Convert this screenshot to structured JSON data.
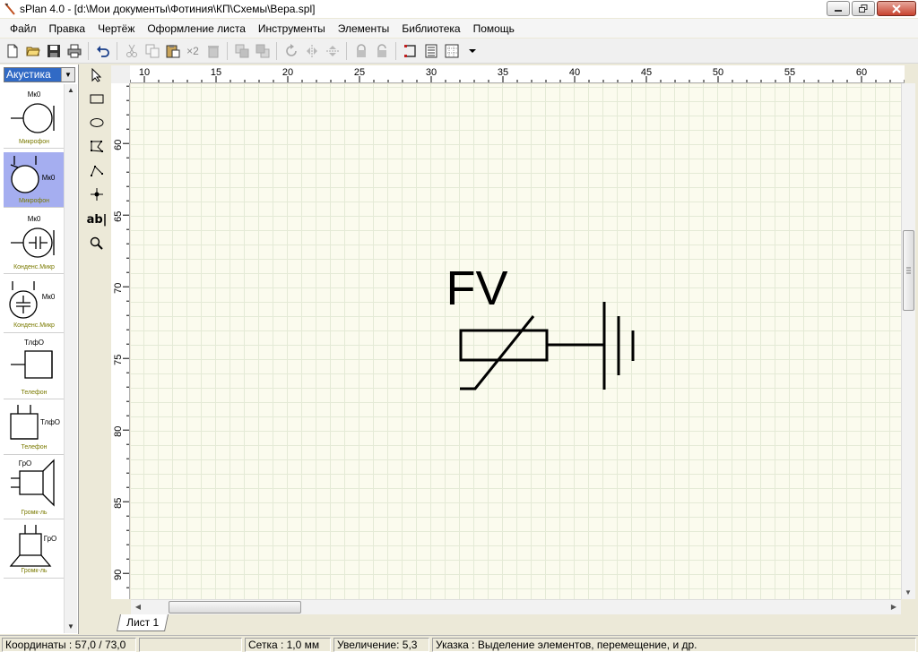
{
  "window": {
    "title": "sPlan 4.0 - [d:\\Мои документы\\Фотиния\\КП\\Схемы\\Вера.spl]"
  },
  "menu": [
    {
      "label": "Файл"
    },
    {
      "label": "Правка"
    },
    {
      "label": "Чертёж"
    },
    {
      "label": "Оформление листа"
    },
    {
      "label": "Инструменты"
    },
    {
      "label": "Элементы"
    },
    {
      "label": "Библиотека"
    },
    {
      "label": "Помощь"
    }
  ],
  "toolbar": {
    "duplicate_label": "×2"
  },
  "library": {
    "selected": "Акустика",
    "items": [
      {
        "caption": "Микрофон",
        "tag": "Мк0",
        "icon": "microphone-icon",
        "selected": false
      },
      {
        "caption": "Микрофон",
        "tag": "Мк0",
        "icon": "microphone-icon",
        "selected": true
      },
      {
        "caption": "Конденс.Микр",
        "tag": "Мк0",
        "icon": "condenser-mic-icon",
        "selected": false
      },
      {
        "caption": "Конденс.Микр",
        "tag": "Мк0",
        "icon": "condenser-mic-icon",
        "selected": false
      },
      {
        "caption": "Телефон",
        "tag": "ТлфО",
        "icon": "phone-icon",
        "selected": false
      },
      {
        "caption": "Телефон",
        "tag": "ТлфО",
        "icon": "phone-icon",
        "selected": false
      },
      {
        "caption": "Громк-ль",
        "tag": "ГрО",
        "icon": "speaker-icon",
        "selected": false
      },
      {
        "caption": "Громк-ль",
        "tag": "ГрО",
        "icon": "horn-speaker-icon",
        "selected": false
      }
    ]
  },
  "tools": {
    "text_tool_label": "ab|"
  },
  "ruler": {
    "top_ticks": [
      "10",
      "15",
      "20",
      "25",
      "30",
      "35",
      "40",
      "45",
      "50",
      "55",
      "60"
    ],
    "left_ticks": [
      "60",
      "65",
      "70",
      "75",
      "80",
      "85",
      "90"
    ]
  },
  "drawing": {
    "component_label": "FV"
  },
  "sheet_tab": "Лист 1",
  "status": {
    "coords": "Координаты : 57,0 / 73,0",
    "grid": "Сетка : 1,0 мм",
    "zoom": "Увеличение: 5,3",
    "hint": "Указка : Выделение элементов, перемещение, и др."
  }
}
